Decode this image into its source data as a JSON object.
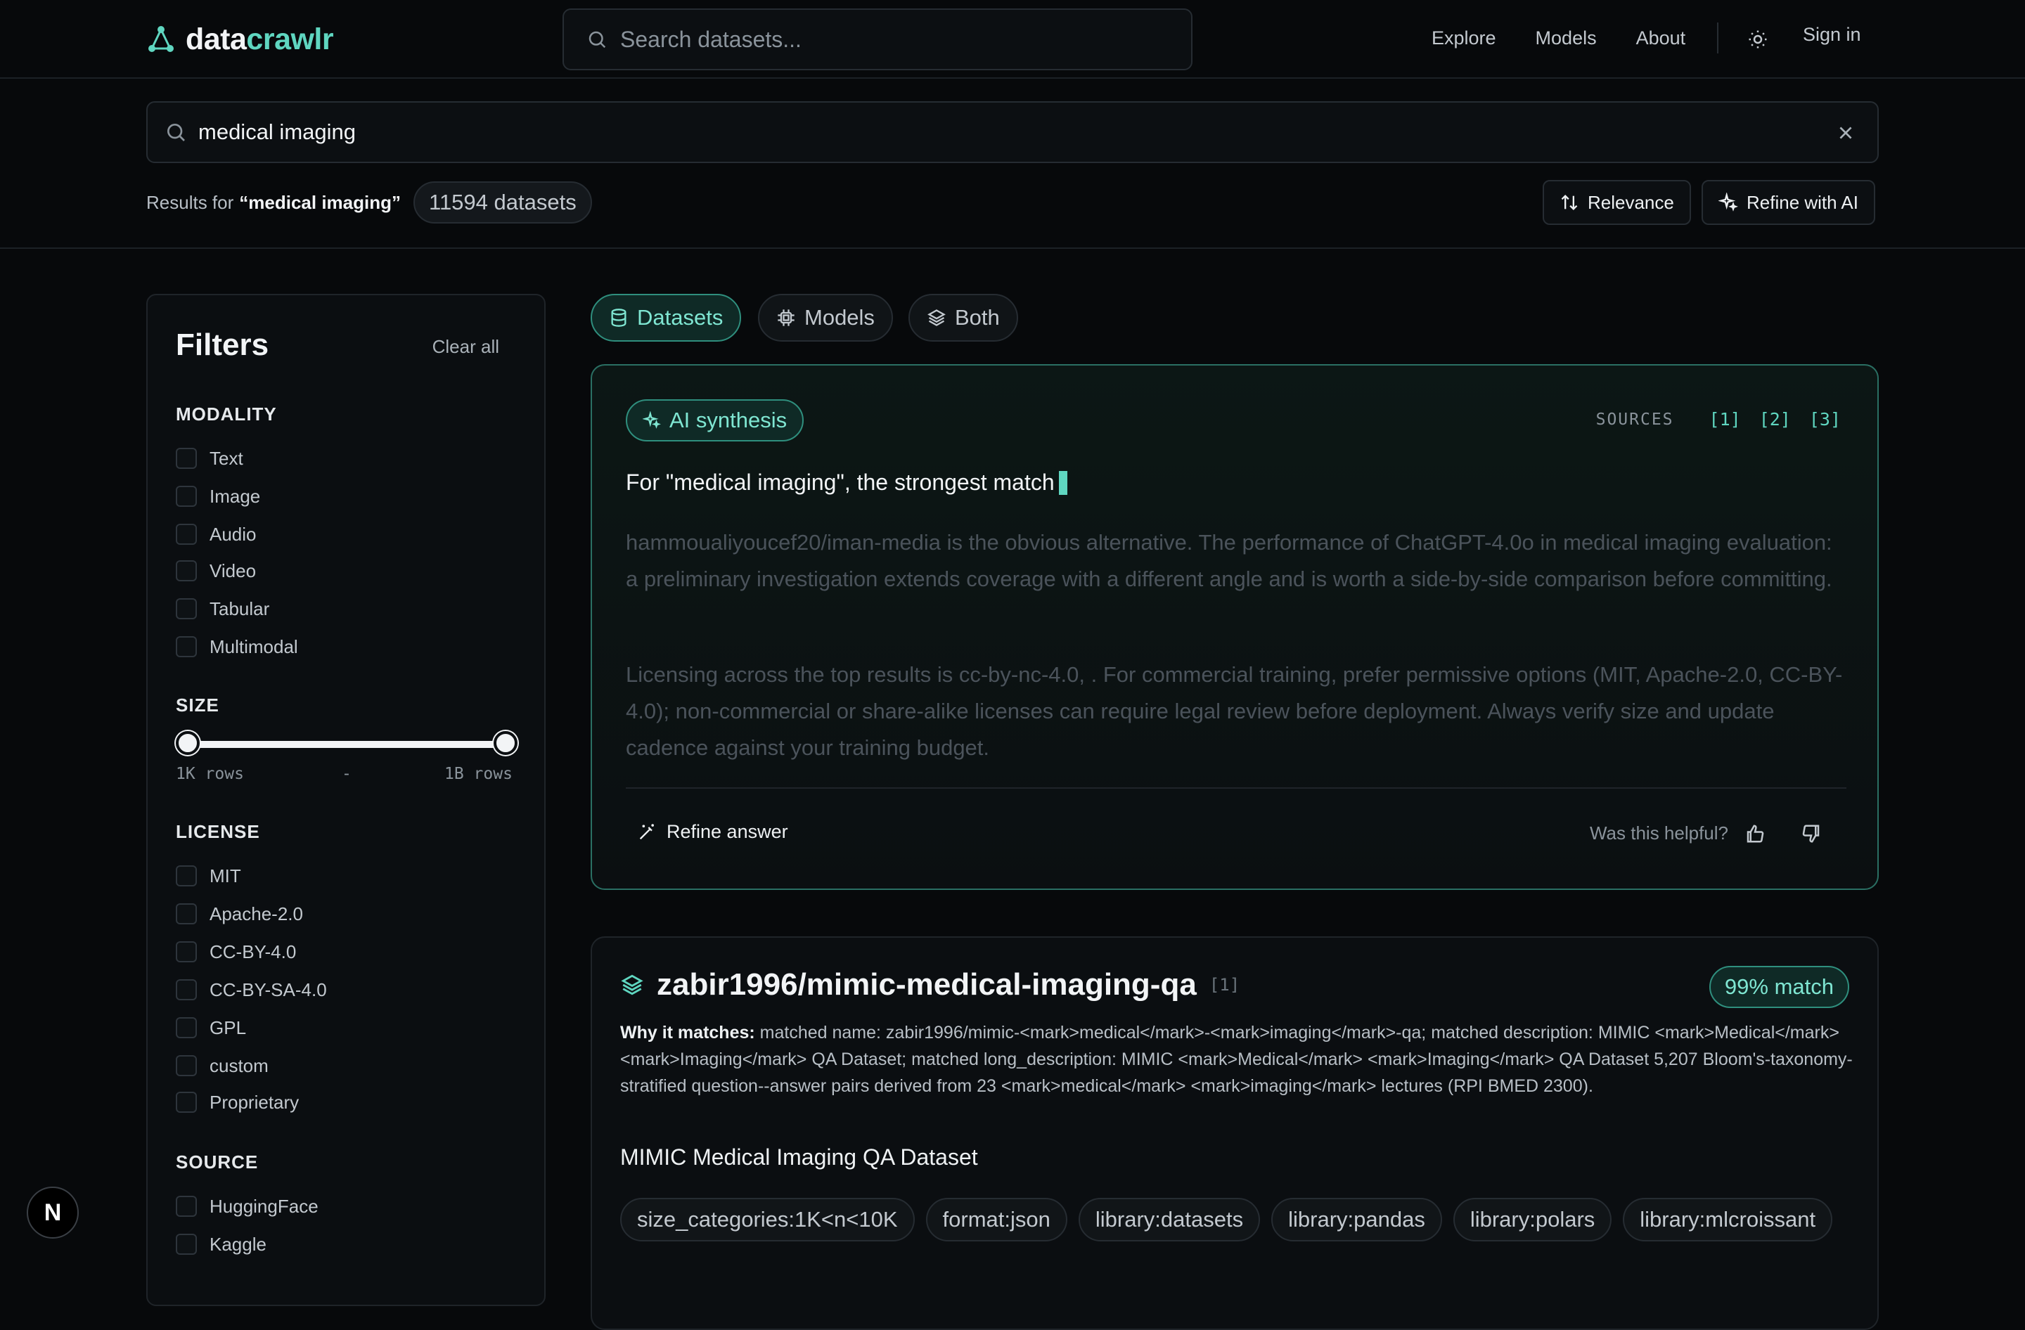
{
  "brand": {
    "part1": "data",
    "part2": "crawlr"
  },
  "header_search": {
    "placeholder": "Search datasets..."
  },
  "nav": {
    "explore": "Explore",
    "models": "Models",
    "about": "About",
    "sign_in": "Sign in"
  },
  "query": {
    "value": "medical imaging"
  },
  "results": {
    "prefix": "Results for",
    "query_quoted": "“medical imaging”",
    "count": "11594 datasets"
  },
  "toolbar": {
    "sort_label": "Relevance",
    "refine_label": "Refine with AI"
  },
  "filters": {
    "title": "Filters",
    "clear_all": "Clear all",
    "modality": {
      "label": "MODALITY",
      "items": [
        "Text",
        "Image",
        "Audio",
        "Video",
        "Tabular",
        "Multimodal"
      ]
    },
    "size": {
      "label": "SIZE",
      "min": "1K rows",
      "sep": "-",
      "max": "1B rows",
      "range_fraction": [
        0,
        1
      ]
    },
    "license": {
      "label": "LICENSE",
      "items": [
        "MIT",
        "Apache-2.0",
        "CC-BY-4.0",
        "CC-BY-SA-4.0",
        "GPL",
        "custom",
        "Proprietary"
      ]
    },
    "source": {
      "label": "SOURCE",
      "items": [
        "HuggingFace",
        "Kaggle"
      ]
    }
  },
  "tabs": [
    {
      "label": "Datasets",
      "icon": "database-icon",
      "active": true
    },
    {
      "label": "Models",
      "icon": "chip-icon",
      "active": false
    },
    {
      "label": "Both",
      "icon": "layers-icon",
      "active": false
    }
  ],
  "ai": {
    "badge": "AI synthesis",
    "sources_label": "SOURCES",
    "sources": [
      "[1]",
      "[2]",
      "[3]"
    ],
    "lead": "For \"medical imaging\", the strongest match",
    "para1": "hammoualiyoucef20/iman-media is the obvious alternative. The performance of ChatGPT-4.0o in medical imaging evaluation: a preliminary investigation extends coverage with a different angle and is worth a side-by-side comparison before committing.",
    "para2": "Licensing across the top results is cc-by-nc-4.0, . For commercial training, prefer permissive options (MIT, Apache-2.0, CC-BY-4.0); non-commercial or share-alike licenses can require legal review before deployment. Always verify size and update cadence against your training budget.",
    "refine": "Refine answer",
    "helpful": "Was this helpful?"
  },
  "result": {
    "name": "zabir1996/mimic-medical-imaging-qa",
    "ref": "[1]",
    "match": "99% match",
    "why_label": "Why it matches:",
    "why_text": "matched name: zabir1996/mimic-<mark>medical</mark>-<mark>imaging</mark>-qa; matched description: MIMIC <mark>Medical</mark> <mark>Imaging</mark> QA Dataset; matched long_description: MIMIC <mark>Medical</mark> <mark>Imaging</mark> QA Dataset 5,207 Bloom's-taxonomy-stratified question--answer pairs derived from 23 <mark>medical</mark> <mark>imaging</mark> lectures (RPI BMED 2300).",
    "description": "MIMIC Medical Imaging QA Dataset",
    "tags": [
      "size_categories:1K<n<10K",
      "format:json",
      "library:datasets",
      "library:pandas",
      "library:polars",
      "library:mlcroissant"
    ]
  },
  "colors": {
    "accent": "#5fd6c0",
    "background": "#07090b"
  }
}
